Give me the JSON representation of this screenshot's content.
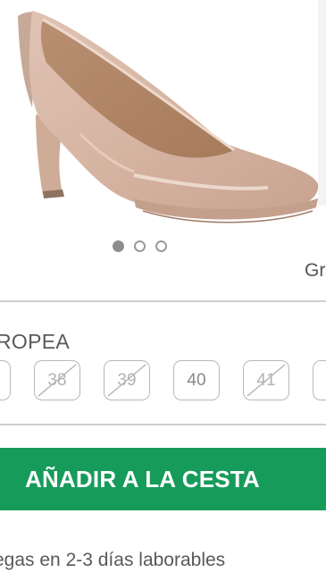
{
  "product": {
    "image_label": "nude patent leather platform pump",
    "carousel": {
      "count": 3,
      "active_index": 0
    },
    "side_label": "Gr"
  },
  "size_selector": {
    "title": "ROPEA",
    "sizes": [
      {
        "label": "",
        "available": true
      },
      {
        "label": "38",
        "available": false
      },
      {
        "label": "39",
        "available": false
      },
      {
        "label": "40",
        "available": true
      },
      {
        "label": "41",
        "available": false
      },
      {
        "label": "4",
        "available": true
      }
    ]
  },
  "cart": {
    "add_label": "AÑADIR A LA CESTA",
    "color": "#179b5a"
  },
  "shipping": {
    "text": "egas en 2-3 días laborables"
  }
}
